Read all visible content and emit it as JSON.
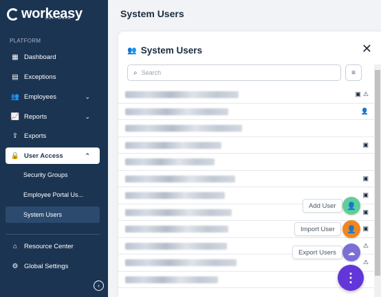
{
  "app": {
    "logo_text": "workeasy",
    "logo_sub": "SOFTWARE"
  },
  "sidebar": {
    "section_label": "PLATFORM",
    "items": [
      {
        "label": "Dashboard",
        "icon": "dashboard-icon"
      },
      {
        "label": "Exceptions",
        "icon": "exceptions-icon"
      },
      {
        "label": "Employees",
        "icon": "employees-icon"
      },
      {
        "label": "Reports",
        "icon": "reports-icon"
      },
      {
        "label": "Exports",
        "icon": "exports-icon"
      },
      {
        "label": "User Access",
        "icon": "lock-icon"
      }
    ],
    "sub_items": [
      {
        "label": "Security Groups"
      },
      {
        "label": "Employee Portal Us..."
      },
      {
        "label": "System Users"
      }
    ],
    "bottom_items": [
      {
        "label": "Resource Center",
        "icon": "home-icon"
      },
      {
        "label": "Global Settings",
        "icon": "gear-icon"
      }
    ]
  },
  "header": {
    "title": "System Users"
  },
  "panel": {
    "title": "System Users",
    "search_placeholder": "Search"
  },
  "fab_actions": [
    {
      "label": "Add User",
      "color": "#5ccf9a"
    },
    {
      "label": "Import User",
      "color": "#f2861e"
    },
    {
      "label": "Export Users",
      "color": "#7b6fd6"
    }
  ],
  "colors": {
    "sidebar_bg": "#1b3452",
    "fab_main": "#6236d9"
  }
}
